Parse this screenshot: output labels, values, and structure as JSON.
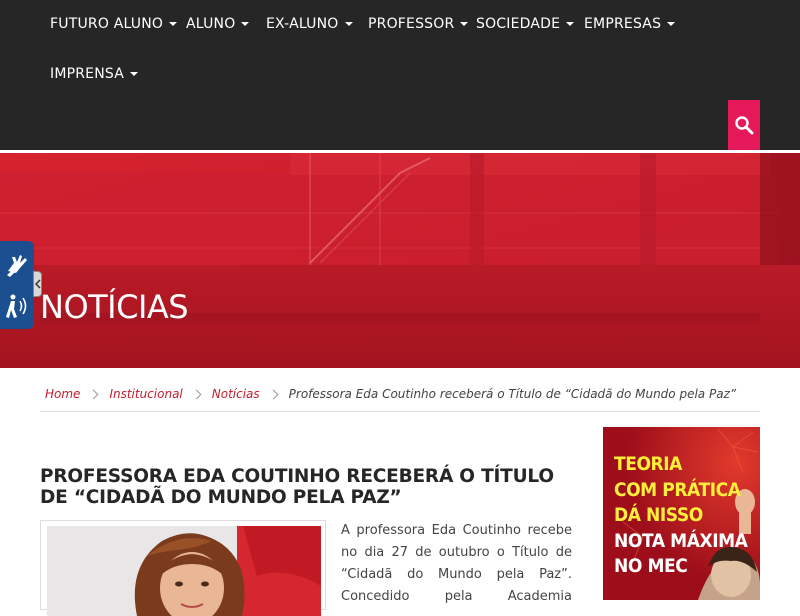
{
  "nav": {
    "items": [
      {
        "label": "FUTURO ALUNO"
      },
      {
        "label": "ALUNO"
      },
      {
        "label": "EX-ALUNO"
      },
      {
        "label": "PROFESSOR"
      },
      {
        "label": "SOCIEDADE"
      },
      {
        "label": "EMPRESAS"
      },
      {
        "label": "IMPRENSA"
      }
    ],
    "search_icon": "search-icon"
  },
  "hero": {
    "title": "NOTÍCIAS"
  },
  "accessibility": {
    "icons": [
      "sign-language-icon",
      "audio-description-icon"
    ]
  },
  "breadcrumb": {
    "items": [
      "Home",
      "Institucional",
      "Notícias"
    ],
    "current": "Professora Eda Coutinho receberá o Título de “Cidadã do Mundo pela Paz”"
  },
  "article": {
    "title": "PROFESSORA EDA COUTINHO RECEBERÁ O TÍTULO DE “CIDADÃ DO MUNDO PELA PAZ”",
    "body": "A professora Eda Coutinho recebe no dia 27 de outubro o Título de “Cidadã do Mundo pela Paz”. Concedido pela Academia"
  },
  "banner": {
    "lines": [
      "TEORIA",
      "COM PRÁTICA",
      "DÁ NISSO",
      "NOTA MÁXIMA",
      "NO MEC"
    ]
  },
  "colors": {
    "accent": "#e5195a",
    "brand_red": "#c41c2c",
    "nav_bg": "#262626",
    "banner_yellow": "#ffef3a"
  }
}
